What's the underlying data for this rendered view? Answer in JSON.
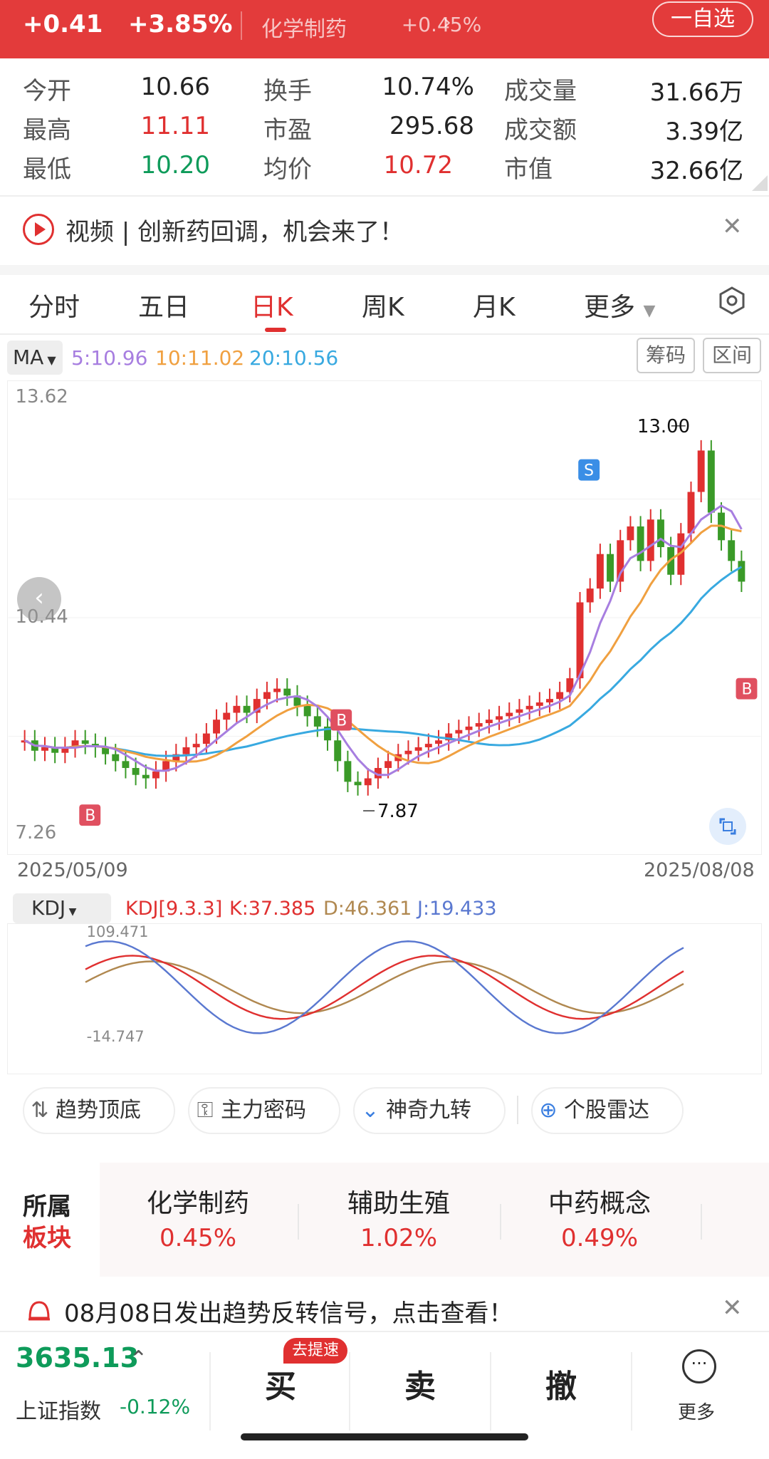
{
  "header": {
    "change_abs": "+0.41",
    "change_pct": "+3.85%",
    "sector_name": "化学制药",
    "sector_pct": "+0.45%",
    "watch_label": "一自选"
  },
  "stats": [
    {
      "label": "今开",
      "value": "10.66",
      "color": "dark"
    },
    {
      "label": "最高",
      "value": "11.11",
      "color": "red"
    },
    {
      "label": "最低",
      "value": "10.20",
      "color": "green"
    },
    {
      "label": "换手",
      "value": "10.74%",
      "color": "dark"
    },
    {
      "label": "市盈",
      "value": "295.68",
      "color": "dark"
    },
    {
      "label": "均价",
      "value": "10.72",
      "color": "red"
    },
    {
      "label": "成交量",
      "value": "31.66万",
      "color": "dark"
    },
    {
      "label": "成交额",
      "value": "3.39亿",
      "color": "dark"
    },
    {
      "label": "市值",
      "value": "32.66亿",
      "color": "dark"
    }
  ],
  "video_banner": {
    "text": "视频 | 创新药回调，机会来了！"
  },
  "tabs": [
    "分时",
    "五日",
    "日K",
    "周K",
    "月K",
    "更多"
  ],
  "active_tab": "日K",
  "ma": {
    "btn": "MA",
    "ma5": "5:10.96",
    "ma10": "10:11.02",
    "ma20": "20:10.56",
    "chip_btn": "筹码",
    "range_btn": "区间"
  },
  "kchart": {
    "ymax_label": "13.62",
    "ymid_label": "10.44",
    "ymin_label": "7.26",
    "start_date": "2025/05/09",
    "end_date": "2025/08/08",
    "high_mark": "13.00",
    "low_mark": "7.87",
    "signal_s": "S",
    "signal_b": "B"
  },
  "kdj": {
    "btn": "KDJ",
    "params": "KDJ[9.3.3]",
    "k": "K:37.385",
    "d": "D:46.361",
    "j": "J:19.433",
    "ymax_label": "109.471",
    "ymin_label": "-14.747"
  },
  "tools": [
    "趋势顶底",
    "主力密码",
    "神奇九转",
    "个股雷达"
  ],
  "sector_card": {
    "title_1": "所属",
    "title_2": "板块",
    "items": [
      {
        "name": "化学制药",
        "pct": "0.45%"
      },
      {
        "name": "辅助生殖",
        "pct": "1.02%"
      },
      {
        "name": "中药概念",
        "pct": "0.49%"
      }
    ]
  },
  "signal_bar": {
    "text": "08月08日发出趋势反转信号，点击查看！"
  },
  "bottom": {
    "index_value": "3635.13",
    "index_name": "上证指数",
    "index_change": "-0.12%",
    "buy": "买",
    "sell": "卖",
    "cancel": "撤",
    "more": "更多",
    "speed_badge": "去提速"
  },
  "colors": {
    "up": "#e03030",
    "down": "#0e9b5a",
    "header": "#e33b3b"
  }
}
